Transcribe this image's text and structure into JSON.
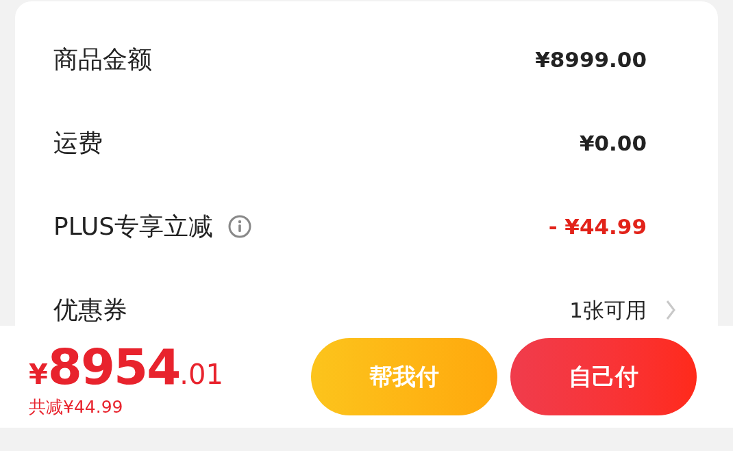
{
  "summary_rows": [
    {
      "label": "商品金额",
      "value": "¥8999.00",
      "kind": "amount",
      "info": false
    },
    {
      "label": "运费",
      "value": "¥0.00",
      "kind": "amount",
      "info": false
    },
    {
      "label": "PLUS专享立减",
      "value": "- ¥44.99",
      "kind": "discount",
      "info": true
    },
    {
      "label": "优惠券",
      "value": "1张可用",
      "kind": "link",
      "info": false
    }
  ],
  "total": {
    "currency": "¥",
    "integer": "8954",
    "decimal": ".01",
    "savings": "共减¥44.99"
  },
  "buttons": [
    {
      "label": "帮我付",
      "kind": "secondary"
    },
    {
      "label": "自己付",
      "kind": "primary"
    }
  ]
}
